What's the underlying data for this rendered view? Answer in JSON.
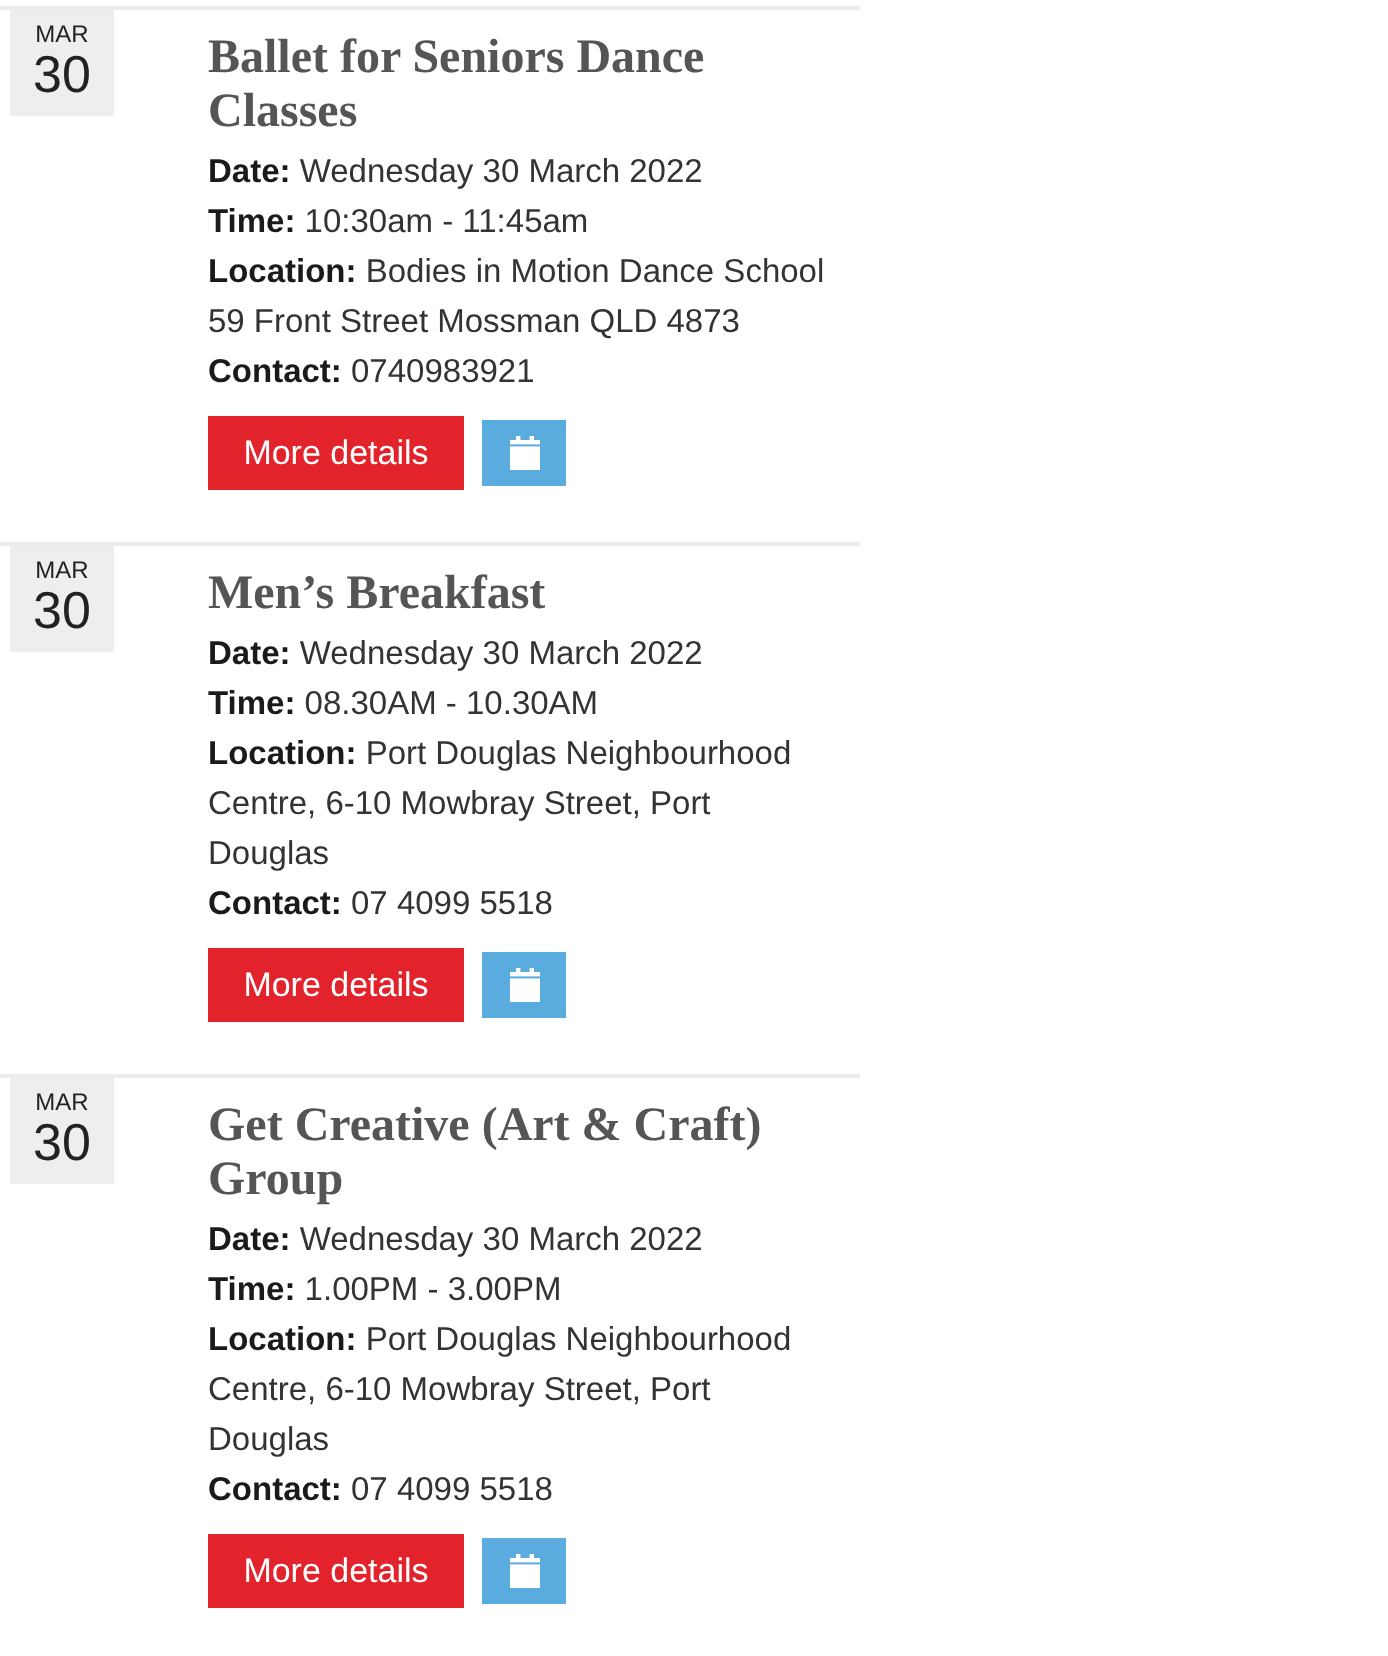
{
  "events": [
    {
      "month": "MAR",
      "day": "30",
      "title": "Ballet for Seniors Dance Classes",
      "details": [
        "**Date:** Wednesday 30 March 2022",
        "**Time:** 10:30am - 11:45am",
        "**Location:** Bodies in Motion Dance School 59 Front Street Mossman QLD 4873",
        "**Contact:** 0740983921"
      ],
      "button": "More details"
    },
    {
      "month": "MAR",
      "day": "30",
      "title": "Men’s Breakfast",
      "details": [
        "**Date:** Wednesday 30 March 2022",
        "**Time:** 08.30AM - 10.30AM",
        "**Location:** Port Douglas Neighbourhood Centre, 6-10 Mowbray Street, Port Douglas",
        "**Contact:** 07 4099 5518"
      ],
      "button": "More details"
    },
    {
      "month": "MAR",
      "day": "30",
      "title": "Get Creative (Art & Craft) Group",
      "details": [
        "**Date:** Wednesday 30 March 2022",
        "**Time:** 1.00PM - 3.00PM",
        "**Location:** Port Douglas Neighbourhood Centre, 6-10 Mowbray Street, Port Douglas",
        "**Contact:** 07 4099 5518"
      ],
      "button": "More details"
    }
  ]
}
